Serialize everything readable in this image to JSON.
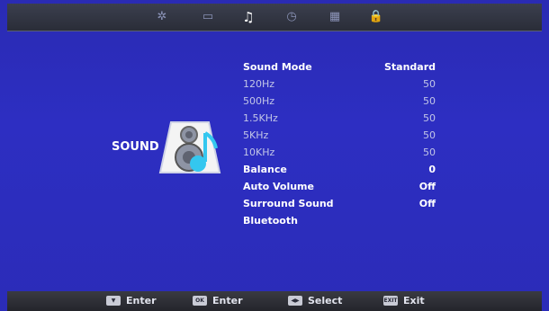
{
  "topbar": {
    "tabs": [
      {
        "icon": "gear-icon",
        "glyph": "✲"
      },
      {
        "icon": "monitor-icon",
        "glyph": "▭"
      },
      {
        "icon": "music-note-icon",
        "glyph": "♫"
      },
      {
        "icon": "clock-icon",
        "glyph": "◷"
      },
      {
        "icon": "grid-icon",
        "glyph": "▦"
      },
      {
        "icon": "lock-icon",
        "glyph": "🔒"
      }
    ],
    "active_tab": "music-note-icon"
  },
  "section": {
    "title": "SOUND"
  },
  "settings": [
    {
      "label": "Sound Mode",
      "value": "Standard"
    },
    {
      "label": "120Hz",
      "value": "50"
    },
    {
      "label": "500Hz",
      "value": "50"
    },
    {
      "label": "1.5KHz",
      "value": "50"
    },
    {
      "label": "5KHz",
      "value": "50"
    },
    {
      "label": "10KHz",
      "value": "50"
    },
    {
      "label": "Balance",
      "value": "0"
    },
    {
      "label": "Auto Volume",
      "value": "Off"
    },
    {
      "label": "Surround Sound",
      "value": "Off"
    },
    {
      "label": "Bluetooth",
      "value": ""
    }
  ],
  "footer": [
    {
      "key_label": "",
      "key_icon": "down-arrow-key-icon",
      "text": "Enter"
    },
    {
      "key_label": "OK",
      "key_icon": "ok-key-icon",
      "text": "Enter"
    },
    {
      "key_label": "◀▶",
      "key_icon": "left-right-key-icon",
      "text": "Select"
    },
    {
      "key_label": "EXIT",
      "key_icon": "exit-key-icon",
      "text": "Exit"
    }
  ],
  "colors": {
    "background": "#2d2ec2",
    "topbar": "#2f3240",
    "footer": "#2b2c33",
    "text": "#ffffff",
    "dim_text": "#c2c6e7"
  }
}
